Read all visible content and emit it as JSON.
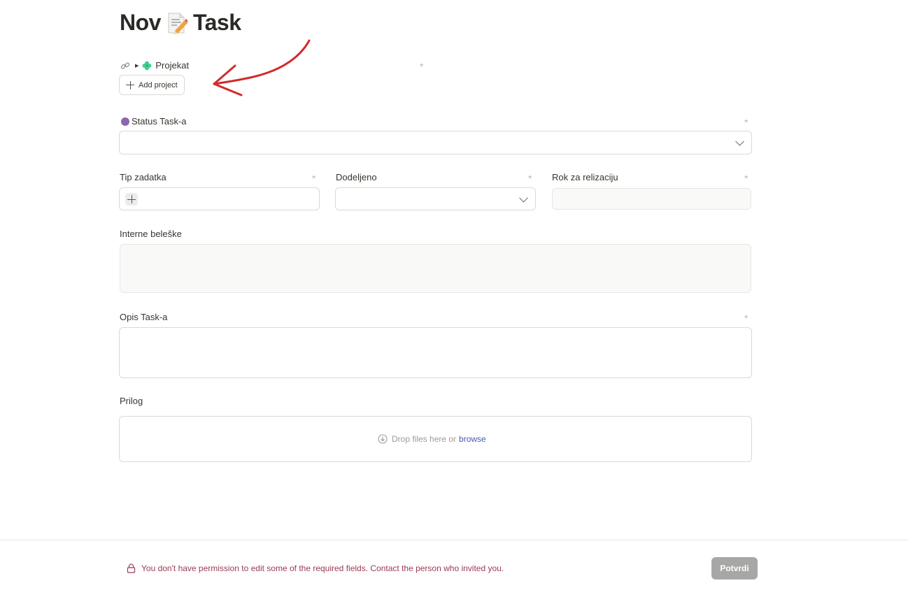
{
  "page": {
    "title_prefix": "Nov",
    "title_suffix": "Task",
    "title_icon": "memo-pencil-icon"
  },
  "project_field": {
    "label": "Projekat",
    "link_icon": "link-icon",
    "relation_icon": "clover-icon",
    "required_mark": "*",
    "add_button_label": "Add project"
  },
  "status_field": {
    "label": "Status Task-a",
    "dot_color": "#9065b0",
    "required_mark": "*",
    "value": ""
  },
  "task_type_field": {
    "label": "Tip zadatka",
    "required_mark": "*"
  },
  "assigned_field": {
    "label": "Dodeljeno",
    "required_mark": "*",
    "value": ""
  },
  "deadline_field": {
    "label": "Rok za relizaciju",
    "required_mark": "*",
    "value": ""
  },
  "internal_notes_field": {
    "label": "Interne beleške",
    "value": ""
  },
  "description_field": {
    "label": "Opis Task-a",
    "required_mark": "*",
    "value": ""
  },
  "attachment_field": {
    "label": "Prilog",
    "drop_text": "Drop files here or",
    "browse_link": "browse"
  },
  "footer": {
    "permission_warning": "You don't have permission to edit some of the required fields. Contact the person who invited you.",
    "submit_label": "Potvrdi",
    "warning_color": "#9b3a52"
  },
  "annotation": {
    "arrow_color": "#d42a2a"
  }
}
